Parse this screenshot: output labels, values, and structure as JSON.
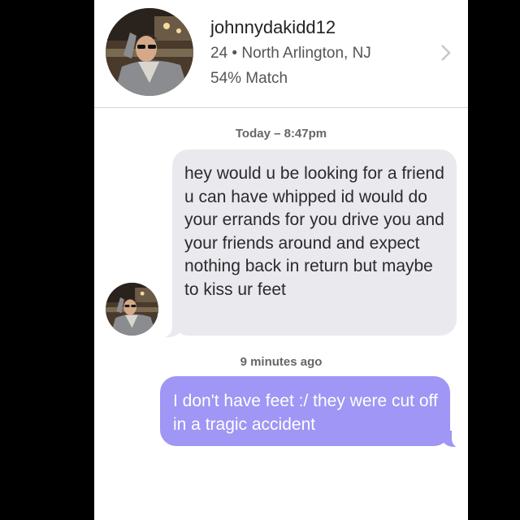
{
  "profile": {
    "username": "johnnydakidd12",
    "details": "24 • North Arlington, NJ",
    "match": "54% Match"
  },
  "chat": {
    "timestamp_1": "Today – 8:47pm",
    "incoming_message": "hey would u be looking for a friend u can have whipped id would do your errands for you drive you and your friends around and expect nothing back in return but maybe to kiss ur feet",
    "timestamp_2": "9 minutes ago",
    "outgoing_message": "I don't have feet :/ they were cut off in a tragic accident"
  },
  "icons": {
    "chevron": "chevron-right-icon",
    "avatar": "user-avatar-photo"
  },
  "colors": {
    "outgoing_bubble": "#9f96f5",
    "incoming_bubble": "#e9e9ee"
  }
}
